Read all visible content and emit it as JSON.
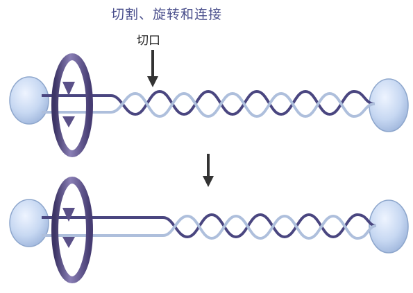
{
  "labels": {
    "title": "切割、旋转和连接",
    "cut": "切口"
  },
  "colors": {
    "strand_dark": "#4a4680",
    "strand_light": "#aebfdc",
    "anchor_fill": "#c9d9f1",
    "anchor_stroke": "#8da6cc",
    "arrow": "#333333",
    "rotation_ring": "#5a5088"
  },
  "icons": [
    "rotation-arrow-icon",
    "down-arrow-icon"
  ]
}
